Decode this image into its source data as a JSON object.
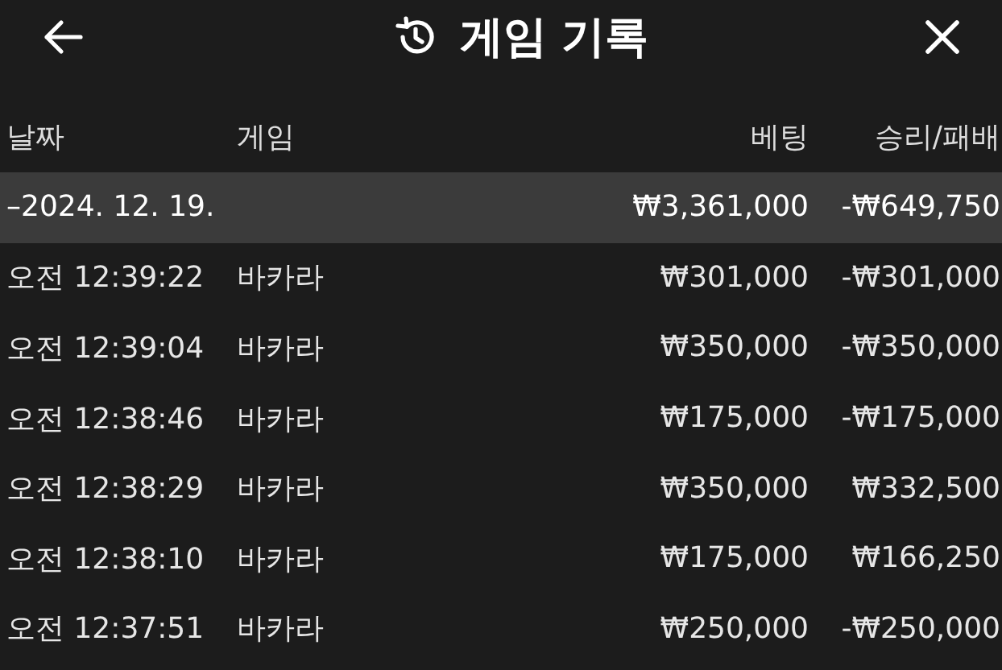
{
  "header": {
    "title": "게임 기록"
  },
  "table": {
    "columns": [
      "날짜",
      "게임",
      "베팅",
      "승리/패배"
    ],
    "group": {
      "date": "–2024. 12. 19.",
      "bet": "₩3,361,000",
      "result": "-₩649,750"
    },
    "rows": [
      {
        "time": "오전 12:39:22",
        "game": "바카라",
        "bet": "₩301,000",
        "result": "-₩301,000"
      },
      {
        "time": "오전 12:39:04",
        "game": "바카라",
        "bet": "₩350,000",
        "result": "-₩350,000"
      },
      {
        "time": "오전 12:38:46",
        "game": "바카라",
        "bet": "₩175,000",
        "result": "-₩175,000"
      },
      {
        "time": "오전 12:38:29",
        "game": "바카라",
        "bet": "₩350,000",
        "result": "₩332,500"
      },
      {
        "time": "오전 12:38:10",
        "game": "바카라",
        "bet": "₩175,000",
        "result": "₩166,250"
      },
      {
        "time": "오전 12:37:51",
        "game": "바카라",
        "bet": "₩250,000",
        "result": "-₩250,000"
      }
    ]
  }
}
